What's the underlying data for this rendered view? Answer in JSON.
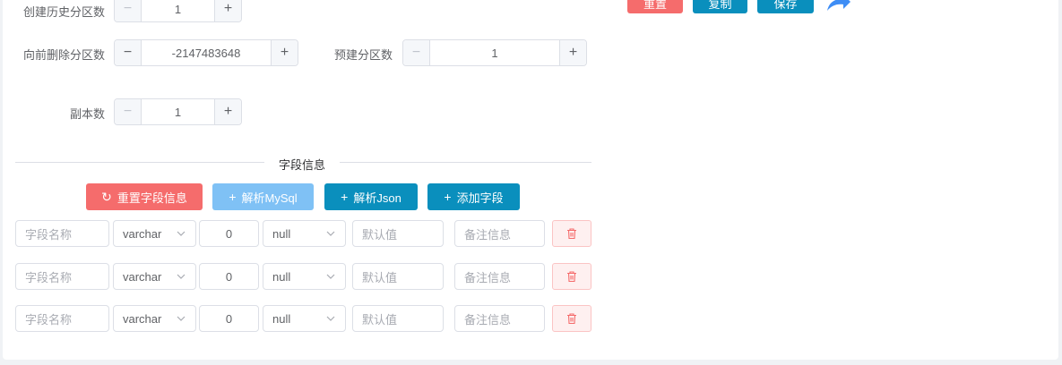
{
  "form": {
    "history_partitions": {
      "label": "创建历史分区数",
      "value": "1"
    },
    "delete_partitions": {
      "label": "向前删除分区数",
      "value": "-2147483648"
    },
    "prebuild_partitions": {
      "label": "预建分区数",
      "value": "1"
    },
    "replicas": {
      "label": "副本数",
      "value": "1"
    }
  },
  "top_actions": {
    "reset_label": "重置",
    "copy_label": "复制",
    "save_label": "保存"
  },
  "fields_section": {
    "title": "字段信息",
    "buttons": {
      "reset": "重置字段信息",
      "parse_mysql": "解析MySql",
      "parse_json": "解析Json",
      "add_field": "添加字段"
    },
    "placeholders": {
      "name": "字段名称",
      "default": "默认值",
      "comment": "备注信息"
    },
    "rows": [
      {
        "type": "varchar",
        "length": "0",
        "nullable": "null"
      },
      {
        "type": "varchar",
        "length": "0",
        "nullable": "null"
      },
      {
        "type": "varchar",
        "length": "0",
        "nullable": "null"
      }
    ]
  },
  "colors": {
    "danger": "#f56c6c",
    "primary": "#0a8fbd",
    "primary_light": "#7fc1f5",
    "redo_icon": "#3e8df5"
  },
  "icons": [
    "minus-icon",
    "plus-icon",
    "refresh-icon",
    "chevron-down-icon",
    "trash-icon",
    "redo-arrow-icon"
  ]
}
